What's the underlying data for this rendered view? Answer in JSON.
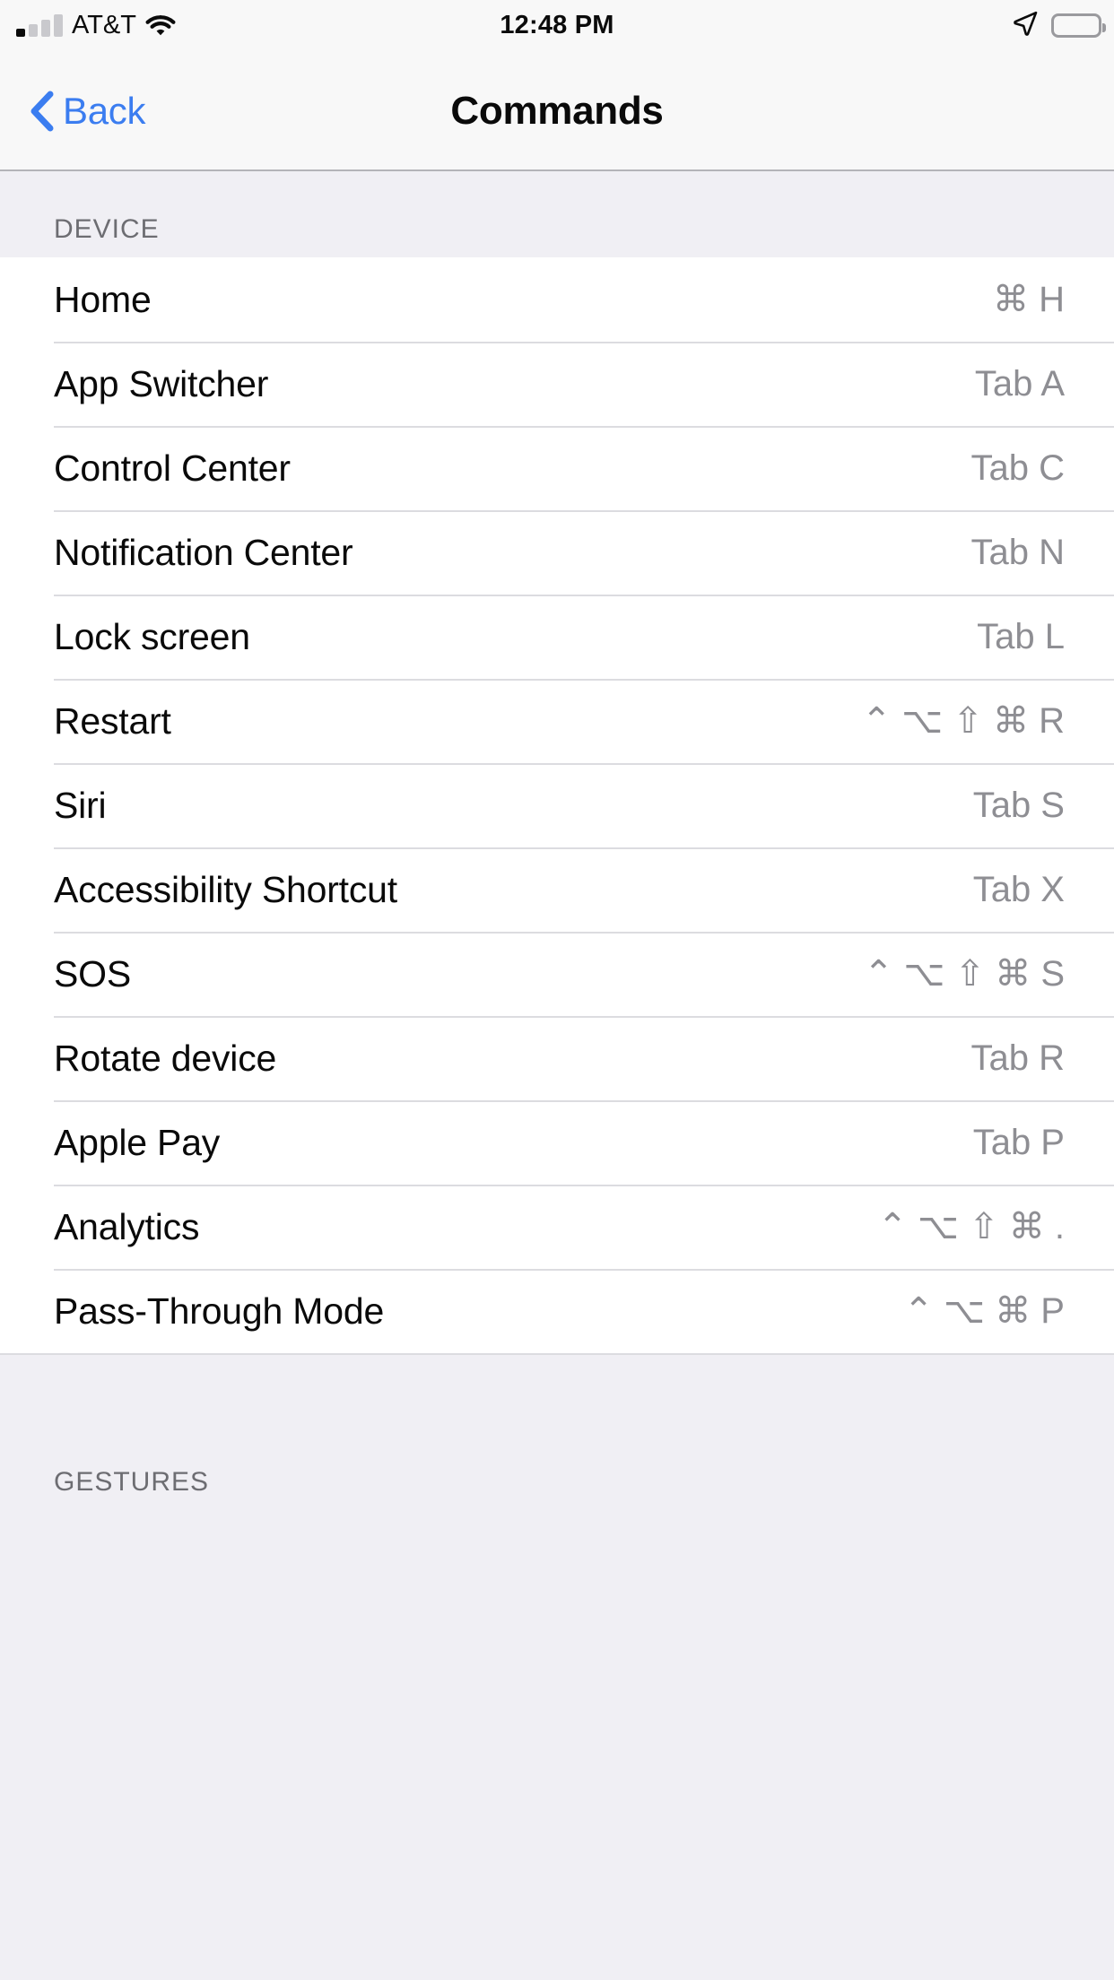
{
  "status_bar": {
    "carrier": "AT&T",
    "time": "12:48 PM",
    "signal_bars_filled": 1,
    "signal_bars_total": 4,
    "wifi_icon": "wifi-icon",
    "location_icon": "location-arrow-icon",
    "battery_icon": "battery-full-icon"
  },
  "nav": {
    "back_label": "Back",
    "back_icon": "chevron-left-icon",
    "title": "Commands",
    "tint_color": "#3b7df0"
  },
  "sections": [
    {
      "header": "DEVICE",
      "rows": [
        {
          "label": "Home",
          "shortcut": "⌘ H"
        },
        {
          "label": "App Switcher",
          "shortcut": "Tab A"
        },
        {
          "label": "Control Center",
          "shortcut": "Tab C"
        },
        {
          "label": "Notification Center",
          "shortcut": "Tab N"
        },
        {
          "label": "Lock screen",
          "shortcut": "Tab L"
        },
        {
          "label": "Restart",
          "shortcut": "⌃ ⌥ ⇧ ⌘ R"
        },
        {
          "label": "Siri",
          "shortcut": "Tab S"
        },
        {
          "label": "Accessibility Shortcut",
          "shortcut": "Tab X"
        },
        {
          "label": "SOS",
          "shortcut": "⌃ ⌥ ⇧ ⌘ S"
        },
        {
          "label": "Rotate device",
          "shortcut": "Tab R"
        },
        {
          "label": "Apple Pay",
          "shortcut": "Tab P"
        },
        {
          "label": "Analytics",
          "shortcut": "⌃ ⌥ ⇧ ⌘ ."
        },
        {
          "label": "Pass-Through Mode",
          "shortcut": "⌃ ⌥ ⌘ P"
        }
      ]
    },
    {
      "header": "GESTURES",
      "rows": []
    }
  ],
  "colors": {
    "group_background": "#f0eff4",
    "row_background": "#ffffff",
    "separator": "#dcdce0",
    "secondary_text": "#8e8e93",
    "header_text": "#6d6d72",
    "primary_text": "#0a0a0a"
  }
}
